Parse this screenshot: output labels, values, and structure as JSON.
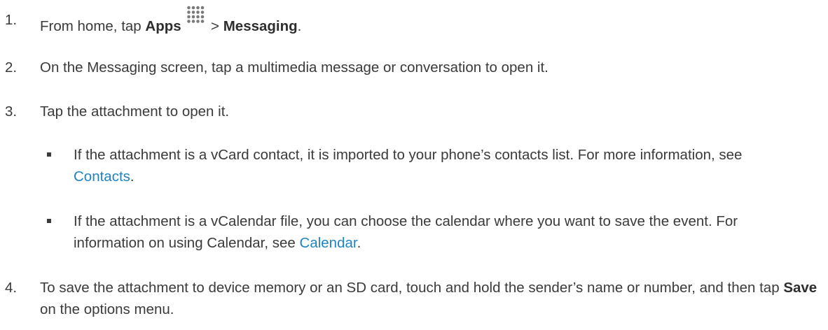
{
  "steps": [
    {
      "number": "1.",
      "pre": "From home, tap ",
      "apps_label": "Apps",
      "apps_icon": "apps-grid-icon",
      "separator": " > ",
      "messaging_label": "Messaging",
      "post": "."
    },
    {
      "number": "2.",
      "text": "On the Messaging screen, tap a multimedia message or conversation to open it."
    },
    {
      "number": "3.",
      "text": "Tap the attachment to open it."
    },
    {
      "number": "4.",
      "pre": "To save the attachment to device memory or an SD card, touch and hold the sender’s name or number, and then tap ",
      "save_label": "Save",
      "post": " on the options menu."
    }
  ],
  "bullets": [
    {
      "pre": "If the attachment is a vCard contact, it is imported to your phone’s contacts list. For more information, see ",
      "link": "Contacts",
      "post": "."
    },
    {
      "pre": "If the attachment is a vCalendar file, you can choose the calendar where you want to save the event. For information on using Calendar, see ",
      "link": "Calendar",
      "post": "."
    }
  ],
  "colors": {
    "text": "#3a3a3a",
    "link": "#1f83c4"
  }
}
